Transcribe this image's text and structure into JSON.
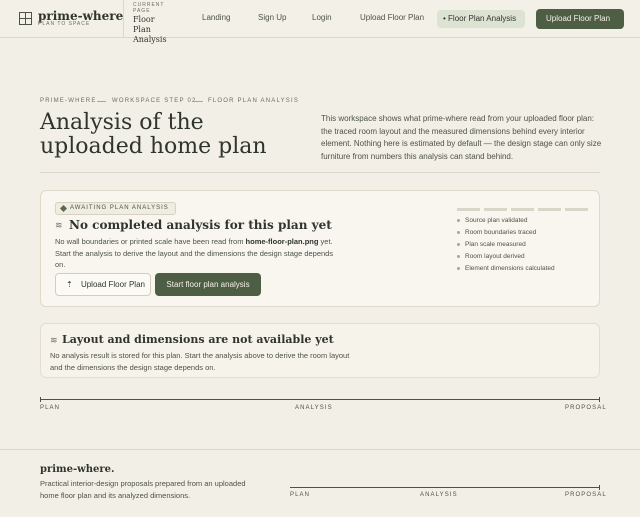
{
  "header": {
    "brand_name": "prime-where",
    "brand_tagline": "PLAN TO SPACE",
    "current_page_label": "CURRENT PAGE",
    "current_page_value": "Floor Plan Analysis",
    "nav": [
      {
        "label": "Landing"
      },
      {
        "label": "Sign Up"
      },
      {
        "label": "Login"
      },
      {
        "label": "Upload Floor Plan"
      }
    ],
    "active_nav": "Floor Plan Analysis",
    "cta_label": "Upload Floor Plan",
    "cta_arrow": "→"
  },
  "hero": {
    "breadcrumb": [
      "PRIME-WHERE",
      "WORKSPACE STEP 02",
      "FLOOR PLAN ANALYSIS"
    ],
    "title": "Analysis of the uploaded home plan",
    "description": "This workspace shows what prime-where read from your uploaded floor plan: the traced room layout and the measured dimensions behind every interior element. Nothing here is estimated by default — the design stage can only size furniture from numbers this analysis can stand behind."
  },
  "analysis_card": {
    "badge": "AWAITING PLAN ANALYSIS",
    "title": "No completed analysis for this plan yet",
    "text_before": "No wall boundaries or printed scale have been read from ",
    "file_name": "home-floor-plan.png",
    "text_after": " yet. Start the analysis to derive the layout and the dimensions the design stage depends on.",
    "upload_button": "Upload Floor Plan",
    "start_button": "Start floor plan analysis",
    "steps_complete": 0,
    "checklist": [
      "Source plan validated",
      "Room boundaries traced",
      "Plan scale measured",
      "Room layout derived",
      "Element dimensions calculated"
    ]
  },
  "layout_card": {
    "title": "Layout and dimensions are not available yet",
    "text": "No analysis result is stored for this plan. Start the analysis above to derive the room layout and the dimensions the design stage depends on."
  },
  "progress": {
    "steps": [
      "PLAN",
      "ANALYSIS",
      "PROPOSAL"
    ]
  },
  "footer": {
    "brand": "prime-where",
    "brand_dot": ".",
    "text": "Practical interior-design proposals prepared from an uploaded home floor plan and its analyzed dimensions.",
    "steps": [
      "PLAN",
      "ANALYSIS",
      "PROPOSAL"
    ]
  },
  "colors": {
    "background": "#f2efe6",
    "accent": "#4d5e45",
    "active_nav_bg": "#dde3d3",
    "text": "#2f352c"
  },
  "icons": {
    "logo": "floor-plan-grid-icon",
    "badge": "diamond-icon",
    "card": "layers-icon",
    "upload": "upload-arrow-icon",
    "cta": "arrow-right-icon"
  }
}
